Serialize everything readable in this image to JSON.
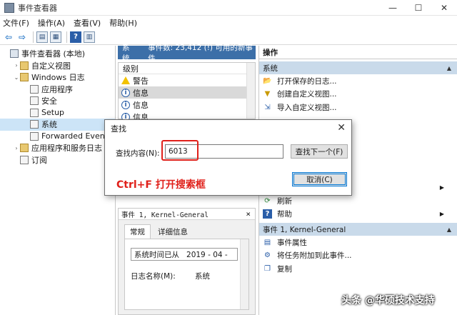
{
  "window": {
    "title": "事件查看器",
    "minimize": "—",
    "maximize": "☐",
    "close": "✕"
  },
  "menu": [
    "文件(F)",
    "操作(A)",
    "查看(V)",
    "帮助(H)"
  ],
  "tree": [
    {
      "label": "事件查看器 (本地)",
      "indent": 0,
      "expander": "",
      "icon": "computer"
    },
    {
      "label": "自定义视图",
      "indent": 1,
      "expander": "›",
      "icon": "folder"
    },
    {
      "label": "Windows 日志",
      "indent": 1,
      "expander": "⌄",
      "icon": "folder"
    },
    {
      "label": "应用程序",
      "indent": 2,
      "expander": "",
      "icon": "log"
    },
    {
      "label": "安全",
      "indent": 2,
      "expander": "",
      "icon": "log"
    },
    {
      "label": "Setup",
      "indent": 2,
      "expander": "",
      "icon": "log"
    },
    {
      "label": "系统",
      "indent": 2,
      "expander": "",
      "icon": "log",
      "selected": true
    },
    {
      "label": "Forwarded Events",
      "indent": 2,
      "expander": "",
      "icon": "log"
    },
    {
      "label": "应用程序和服务日志",
      "indent": 1,
      "expander": "›",
      "icon": "folder"
    },
    {
      "label": "订阅",
      "indent": 1,
      "expander": "",
      "icon": "log"
    }
  ],
  "center": {
    "header_name": "系统",
    "header_count": "事件数: 23,412 (!) 可用的新事件",
    "column_level": "级别",
    "rows": [
      {
        "icon": "warning",
        "label": "警告"
      },
      {
        "icon": "info",
        "label": "信息",
        "selected": true
      },
      {
        "icon": "info",
        "label": "信息"
      },
      {
        "icon": "info",
        "label": "信息"
      }
    ],
    "detail_title": "事件 1, Kernel-General",
    "detail_close": "×",
    "tabs": [
      "常规",
      "详细信息"
    ],
    "detail_line": "系统时间已从   2019 - 04 -",
    "log_name_key": "日志名称(M):",
    "log_name_value": "系统"
  },
  "actions": {
    "header": "操作",
    "section1": "系统",
    "items1": [
      {
        "icon": "open-icon",
        "label": "打开保存的日志..."
      },
      {
        "icon": "filter-icon",
        "label": "创建自定义视图..."
      },
      {
        "icon": "import-icon",
        "label": "导入自定义视图..."
      }
    ],
    "items1b": [
      {
        "icon": "view-icon",
        "label": "查看",
        "more": "▶"
      },
      {
        "icon": "refresh-icon",
        "label": "刷新"
      },
      {
        "icon": "help-icon",
        "label": "帮助",
        "more": "▶"
      }
    ],
    "section2": "事件 1, Kernel-General",
    "items2": [
      {
        "icon": "properties-icon",
        "label": "事件属性"
      },
      {
        "icon": "task-icon",
        "label": "将任务附加到此事件..."
      },
      {
        "icon": "copy-icon",
        "label": "复制"
      }
    ]
  },
  "dialog": {
    "title": "查找",
    "close": "✕",
    "find_label": "查找内容(N):",
    "find_value": "6013",
    "find_next": "查找下一个(F)",
    "cancel": "取消(C)"
  },
  "annotation": "Ctrl+F 打开搜索框",
  "watermark": "头条 @华硕技术支持",
  "colors": {
    "header_blue": "#3c6fa8",
    "section_blue": "#c9daea",
    "annotation_red": "#e0201a"
  }
}
